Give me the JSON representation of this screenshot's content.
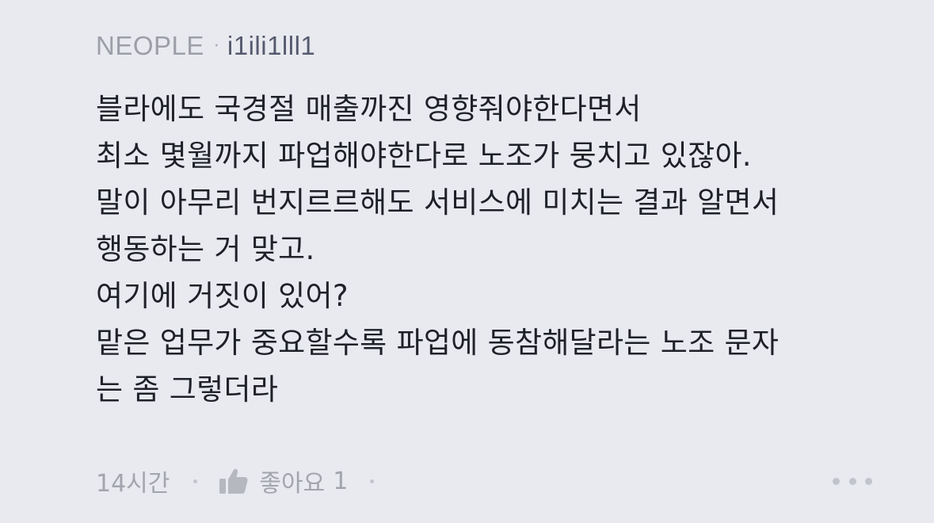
{
  "comment": {
    "company": "NEOPLE",
    "separator": "·",
    "nickname": "i1ili1lll1",
    "lines": [
      "블라에도 국경절 매출까진 영향줘야한다면서",
      "최소 몇월까지 파업해야한다로 노조가 뭉치고 있잖아.",
      "말이 아무리 번지르르해도 서비스에 미치는 결과 알면서",
      "행동하는 거 맞고.",
      "여기에 거짓이 있어?",
      "맡은 업무가 중요할수록 파업에 동참해달라는 노조 문자",
      "는 좀 그렇더라"
    ],
    "time": "14시간",
    "like_label": "좋아요",
    "like_count": "1",
    "icons": {
      "like": "thumbs-up-icon",
      "more": "more-dots-icon"
    },
    "colors": {
      "background": "#e9eaef",
      "text": "#1f2129",
      "meta": "#a3a5ae",
      "nickname": "#555a6e"
    }
  }
}
